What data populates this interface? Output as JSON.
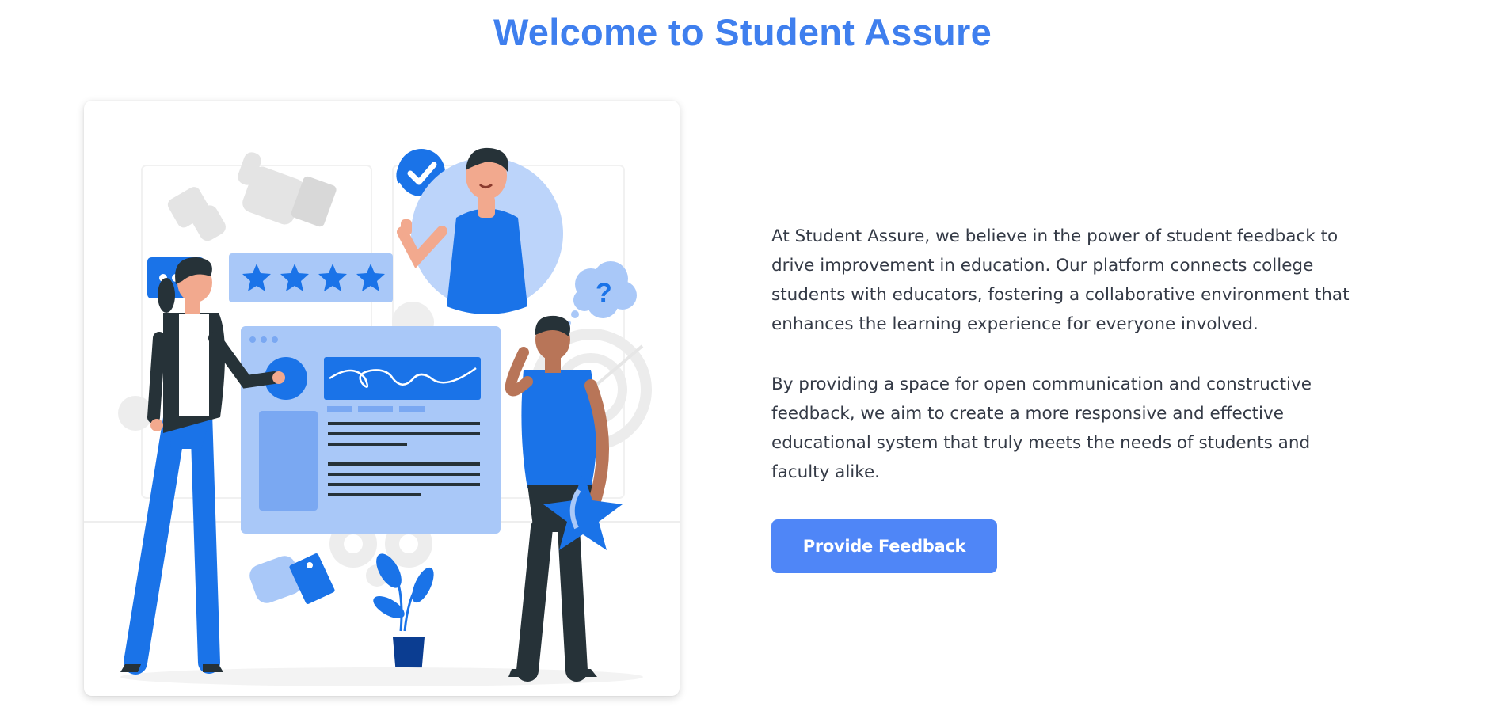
{
  "header": {
    "title": "Welcome to Student Assure"
  },
  "illustration": {
    "description_icon": "feedback-illustration",
    "accent_color": "#1a73e8",
    "light_accent_color": "#a9c8f8"
  },
  "intro": {
    "paragraph_1": "At Student Assure, we believe in the power of student feedback to drive improvement in education. Our platform connects college students with educators, fostering a collaborative environment that enhances the learning experience for everyone involved.",
    "paragraph_2": "By providing a space for open communication and constructive feedback, we aim to create a more responsive and effective educational system that truly meets the needs of students and faculty alike."
  },
  "actions": {
    "feedback_label": "Provide Feedback"
  },
  "colors": {
    "title": "#3f7fee",
    "button_bg": "#4f86f7",
    "body_text": "#343a46"
  }
}
